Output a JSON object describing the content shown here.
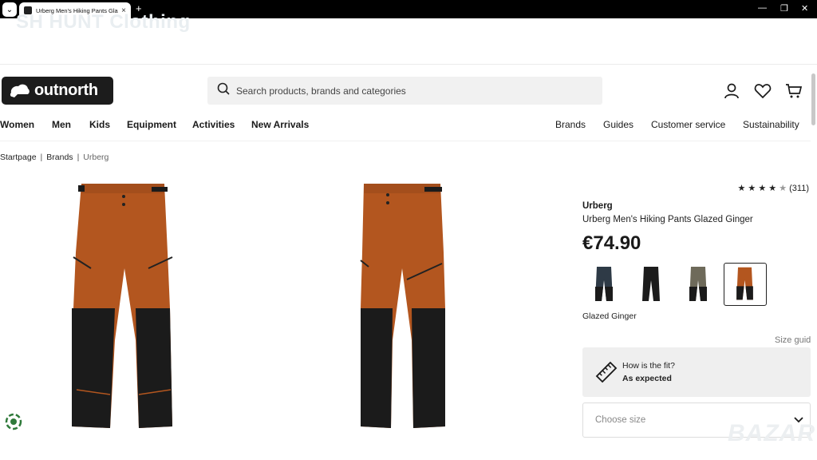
{
  "browser": {
    "tab_title": "Urberg Men's Hiking Pants Glaz",
    "new_tab": "+",
    "close": "×"
  },
  "watermark_top": "SH HUNT Clothing",
  "logo": {
    "text": "outnorth"
  },
  "search": {
    "placeholder": "Search products, brands and categories"
  },
  "nav": {
    "left": [
      "Women",
      "Men",
      "Kids",
      "Equipment",
      "Activities",
      "New Arrivals"
    ],
    "right": [
      "Brands",
      "Guides",
      "Customer service",
      "Sustainability"
    ]
  },
  "breadcrumb": [
    "Startpage",
    "Brands",
    "Urberg"
  ],
  "product": {
    "rating_count": "(311)",
    "rating_value": 4.5,
    "brand": "Urberg",
    "name": "Urberg Men's Hiking Pants Glazed Ginger",
    "price": "€74.90",
    "swatches": [
      {
        "color": "#2e3a46",
        "name": "navy"
      },
      {
        "color": "#1c1c1c",
        "name": "black"
      },
      {
        "color": "#6e6a5a",
        "name": "olive"
      },
      {
        "color": "#b3561f",
        "name": "glazed-ginger"
      }
    ],
    "selected_color": "Glazed Ginger",
    "size_guide": "Size guid",
    "fit": {
      "question": "How is the fit?",
      "answer": "As expected"
    },
    "size_placeholder": "Choose size",
    "colors": {
      "ginger": "#b3561f",
      "dark": "#1b1b1b"
    }
  },
  "watermark_bottom": "BAZAR"
}
